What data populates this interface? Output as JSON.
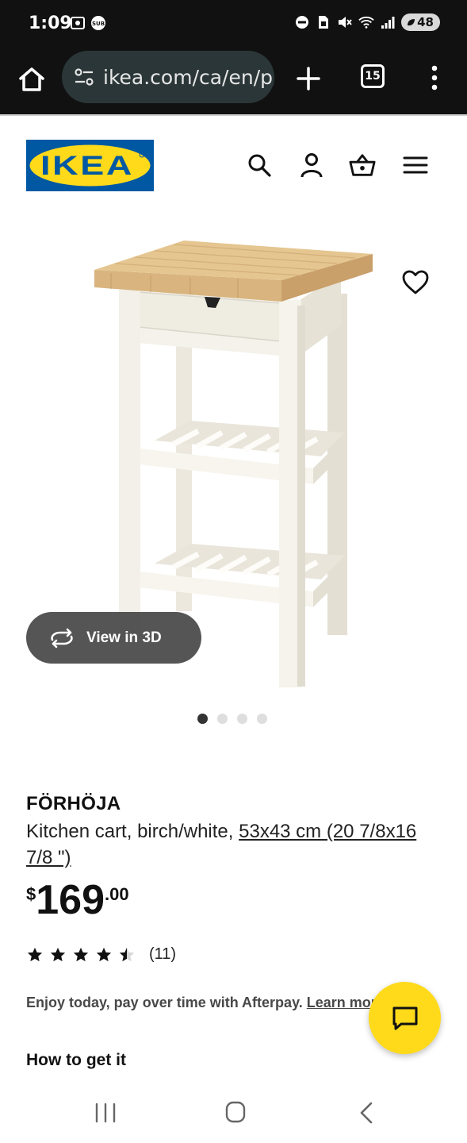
{
  "status_bar": {
    "time": "1:09",
    "battery": "48",
    "icons": [
      "screenshot-icon",
      "app-badge-icon",
      "dnd-icon",
      "sim-icon",
      "mute-icon",
      "wifi-icon",
      "signal-icon"
    ]
  },
  "browser": {
    "url": "ikea.com/ca/en/p/",
    "tab_count": "15"
  },
  "header": {
    "logo_text": "IKEA",
    "icons": [
      "search-icon",
      "account-icon",
      "basket-icon",
      "hamburger-icon"
    ]
  },
  "gallery": {
    "view_3d_label": "View in 3D",
    "slide_count": 4,
    "active_slide": 1
  },
  "product": {
    "name": "FÖRHÖJA",
    "description": "Kitchen cart, birch/white, ",
    "size": "53x43 cm (20 7/8x16 7/8 \")",
    "price": {
      "currency": "$",
      "integer": "169",
      "decimal": ".00"
    },
    "rating": {
      "stars": 4.5,
      "count": "(11)"
    },
    "afterpay_text": "Enjoy today, pay over time with Afterpay. ",
    "afterpay_link": "Learn more",
    "how_to_get_title": "How to get it"
  },
  "colors": {
    "ikea_blue": "#0058a3",
    "ikea_yellow": "#ffda1a",
    "status_bar_bg": "#111111",
    "url_box_bg": "#2b3638"
  }
}
